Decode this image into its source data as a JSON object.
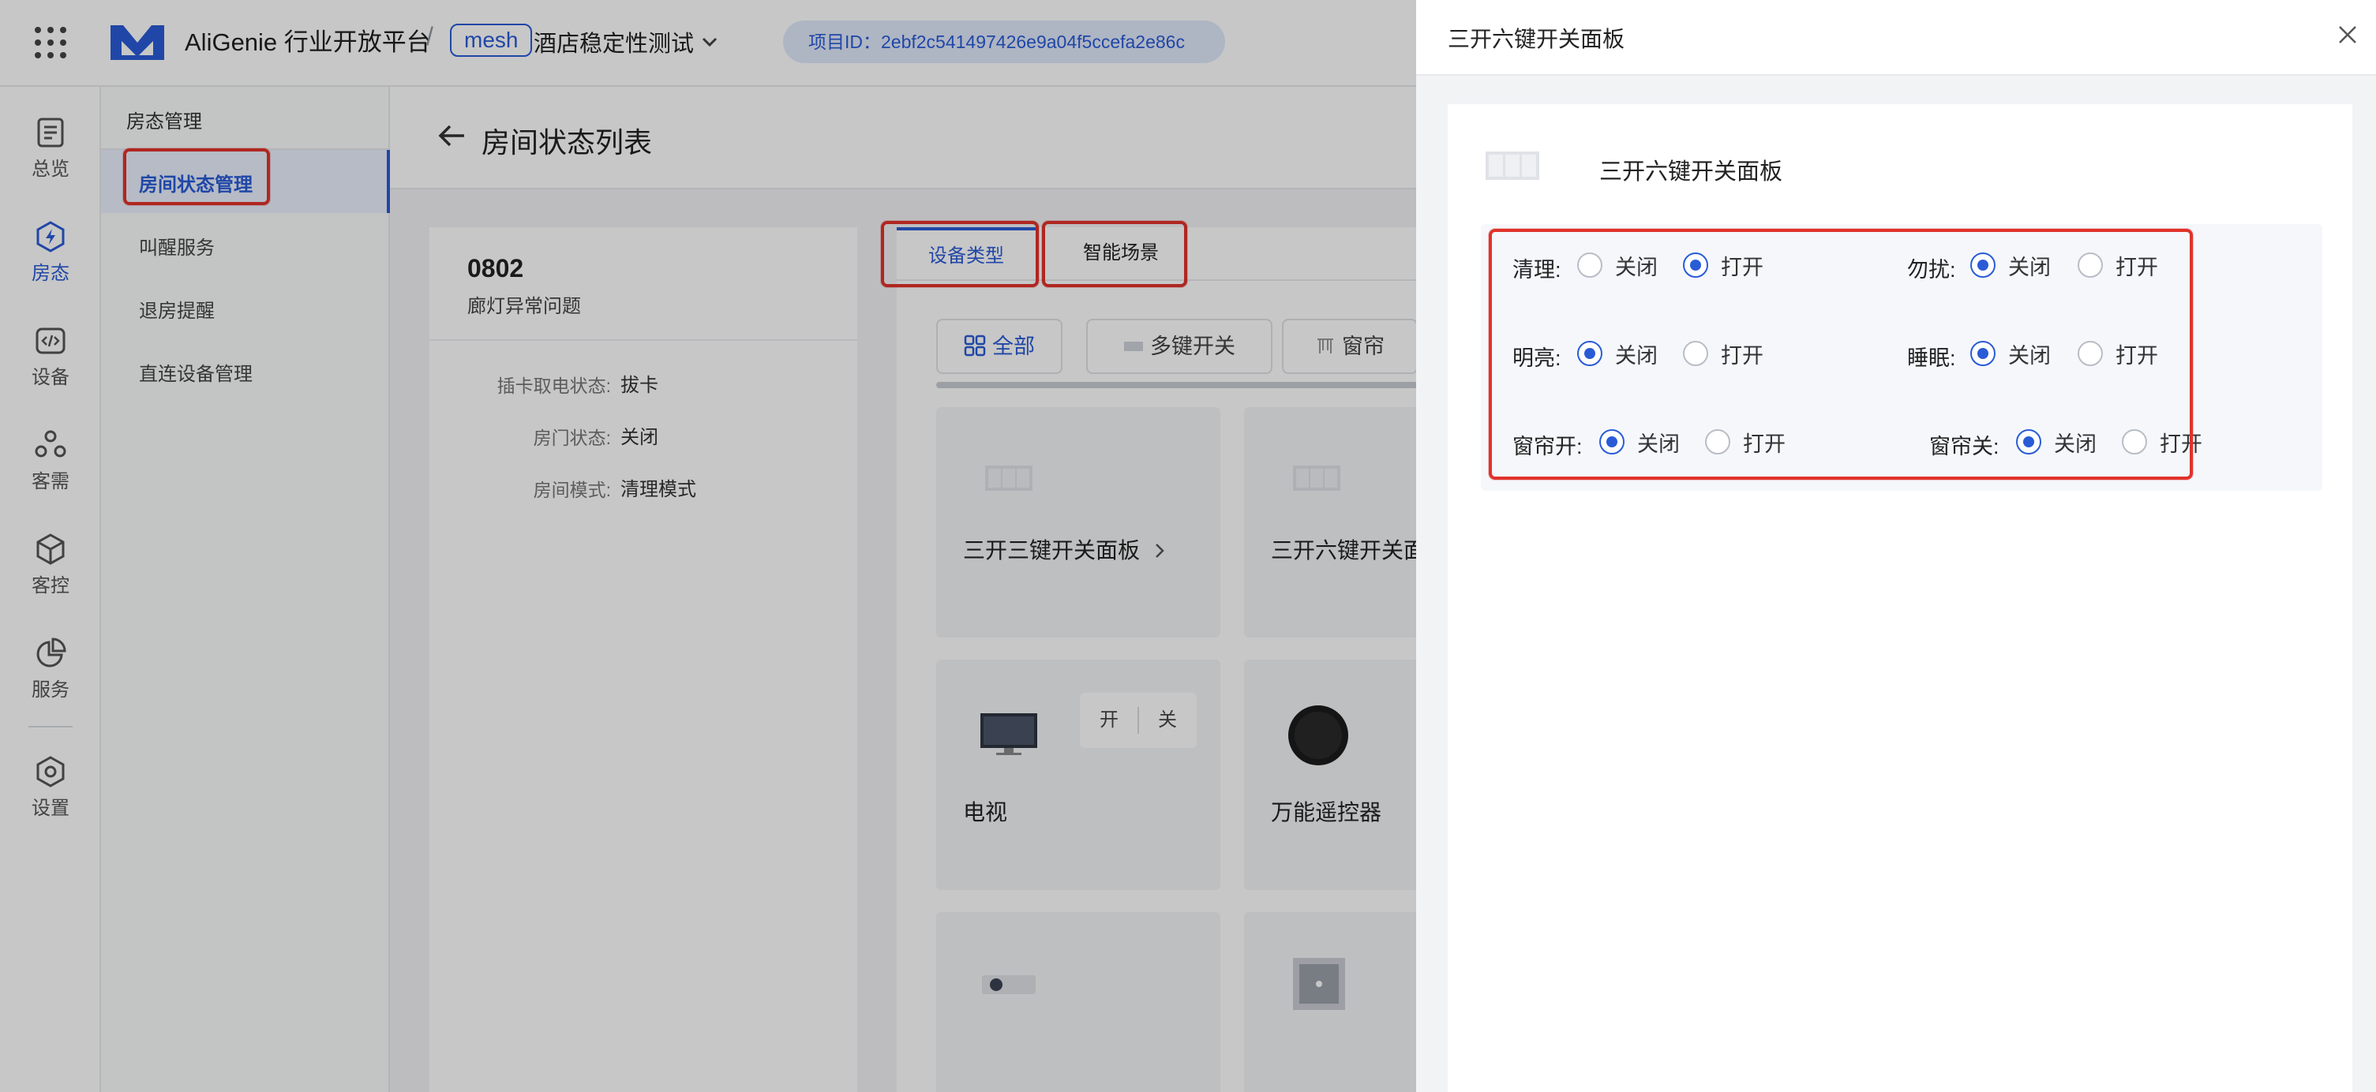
{
  "topbar": {
    "brand": "AliGenie 行业开放平台",
    "separator": "/",
    "mesh_badge": "mesh",
    "project_name": "酒店稳定性测试",
    "project_id": "项目ID：2ebf2c541497426e9a04f5ccefa2e86c"
  },
  "rail": {
    "items": [
      {
        "label": "总览",
        "icon": "list-icon"
      },
      {
        "label": "房态",
        "icon": "lightning-icon"
      },
      {
        "label": "设备",
        "icon": "code-icon"
      },
      {
        "label": "客需",
        "icon": "people-icon"
      },
      {
        "label": "客控",
        "icon": "box-icon"
      },
      {
        "label": "服务",
        "icon": "pie-chart-icon"
      },
      {
        "label": "设置",
        "icon": "gear-icon"
      }
    ]
  },
  "subnav": {
    "title": "房态管理",
    "items": [
      "房间状态管理",
      "叫醒服务",
      "退房提醒",
      "直连设备管理"
    ]
  },
  "page": {
    "title": "房间状态列表"
  },
  "room": {
    "number": "0802",
    "issue": "廊灯异常问题",
    "fields": [
      {
        "label": "插卡取电状态:",
        "value": "拔卡"
      },
      {
        "label": "房门状态:",
        "value": "关闭"
      },
      {
        "label": "房间模式:",
        "value": "清理模式"
      }
    ]
  },
  "devices": {
    "tabs": [
      "设备类型",
      "智能场景"
    ],
    "filters": [
      "全部",
      "多键开关",
      "窗帘"
    ],
    "tiles": [
      "三开三键开关面板",
      "三开六键开关面",
      "电视",
      "万能遥控器"
    ],
    "tv_switch": {
      "on": "开",
      "off": "关"
    }
  },
  "drawer": {
    "title": "三开六键开关面板",
    "device_name": "三开六键开关面板",
    "controls": [
      {
        "label": "清理:",
        "options": [
          "关闭",
          "打开"
        ],
        "selected": 1
      },
      {
        "label": "勿扰:",
        "options": [
          "关闭",
          "打开"
        ],
        "selected": 0
      },
      {
        "label": "明亮:",
        "options": [
          "关闭",
          "打开"
        ],
        "selected": 0
      },
      {
        "label": "睡眠:",
        "options": [
          "关闭",
          "打开"
        ],
        "selected": 0
      },
      {
        "label": "窗帘开:",
        "options": [
          "关闭",
          "打开"
        ],
        "selected": 0
      },
      {
        "label": "窗帘关:",
        "options": [
          "关闭",
          "打开"
        ],
        "selected": 0
      }
    ]
  },
  "colors": {
    "accent": "#2a5bd7",
    "highlight": "#e0332b"
  }
}
